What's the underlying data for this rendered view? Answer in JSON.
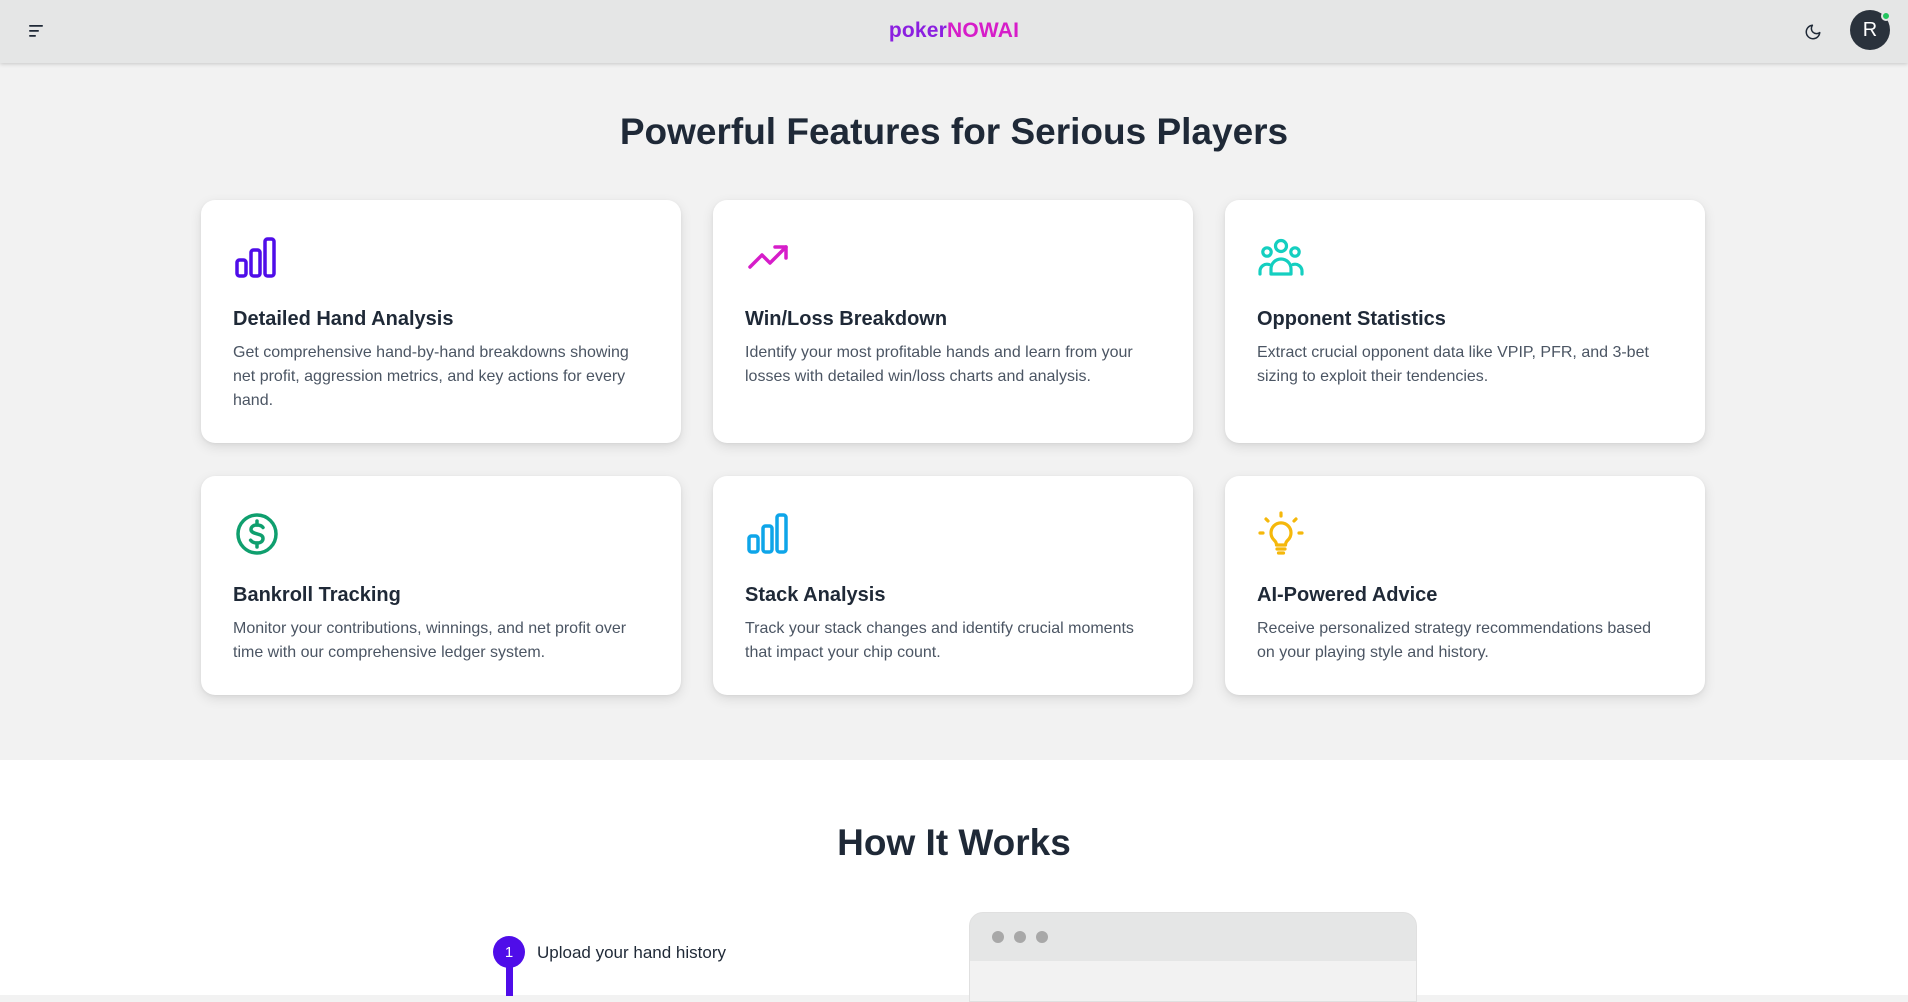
{
  "header": {
    "brand_part1": "poker",
    "brand_part2": "NOWAI",
    "avatar_initial": "R",
    "menu_icon": "hamburger-icon",
    "theme_icon": "moon-icon"
  },
  "features": {
    "title": "Powerful Features for Serious Players",
    "cards": [
      {
        "title": "Detailed Hand Analysis",
        "description": "Get comprehensive hand-by-hand breakdowns showing net profit, aggression metrics, and key actions for every hand.",
        "icon": "bar-chart-icon",
        "color": "#4f0de9"
      },
      {
        "title": "Win/Loss Breakdown",
        "description": "Identify your most profitable hands and learn from your losses with detailed win/loss charts and analysis.",
        "icon": "trending-up-icon",
        "color": "#d61dc9"
      },
      {
        "title": "Opponent Statistics",
        "description": "Extract crucial opponent data like VPIP, PFR, and 3-bet sizing to exploit their tendencies.",
        "icon": "users-icon",
        "color": "#14cfc0"
      },
      {
        "title": "Bankroll Tracking",
        "description": "Monitor your contributions, winnings, and net profit over time with our comprehensive ledger system.",
        "icon": "dollar-circle-icon",
        "color": "#0f9f6e"
      },
      {
        "title": "Stack Analysis",
        "description": "Track your stack changes and identify crucial moments that impact your chip count.",
        "icon": "bar-chart-icon",
        "color": "#0ea5e9"
      },
      {
        "title": "AI-Powered Advice",
        "description": "Receive personalized strategy recommendations based on your playing style and history.",
        "icon": "lightbulb-icon",
        "color": "#f5b80b"
      }
    ]
  },
  "how": {
    "title": "How It Works",
    "steps": [
      {
        "number": "1",
        "label": "Upload your hand history"
      }
    ]
  }
}
